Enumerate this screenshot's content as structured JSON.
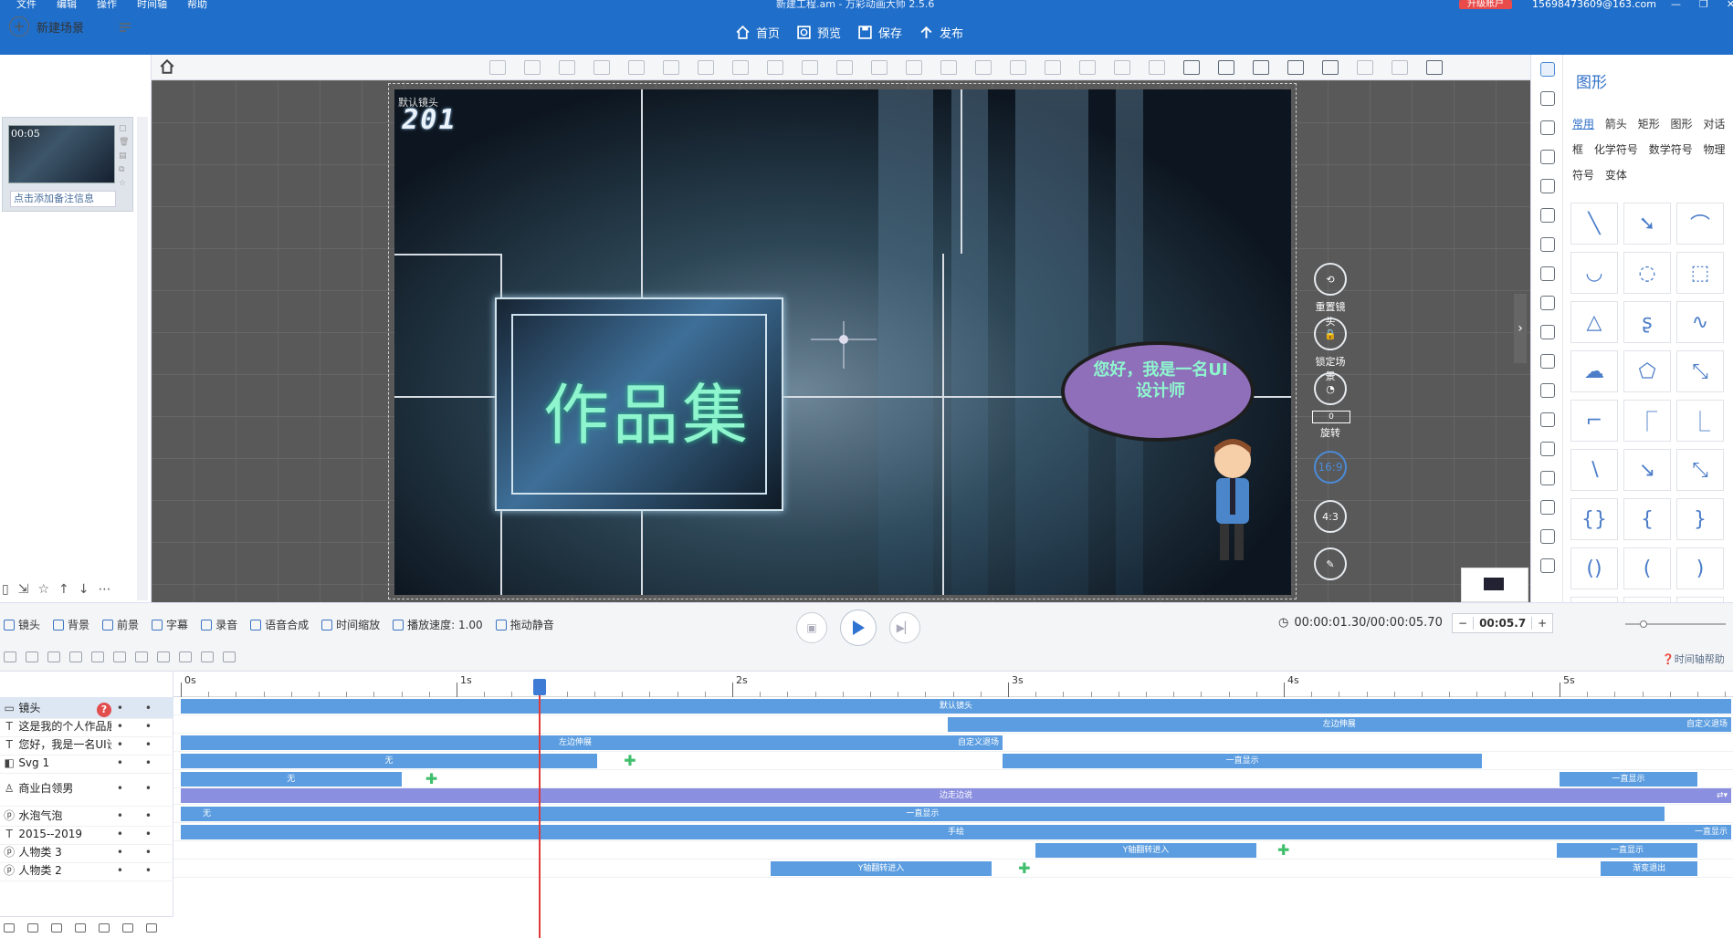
{
  "app": {
    "window_title": "新建工程.am - 万彩动画大师 2.5.6",
    "menu": [
      "文件",
      "编辑",
      "操作",
      "时间轴",
      "帮助"
    ],
    "upgrade_label": "升级账户",
    "account": "15698473609@163.com",
    "window_controls": [
      "—",
      "❐",
      "✕"
    ]
  },
  "top_actions": [
    {
      "label": "首页",
      "icon": "home-icon"
    },
    {
      "label": "预览",
      "icon": "preview-icon"
    },
    {
      "label": "保存",
      "icon": "save-icon"
    },
    {
      "label": "发布",
      "icon": "publish-icon"
    }
  ],
  "scene_panel": {
    "new_scene_label": "新建场景",
    "scene": {
      "time": "00:05",
      "note_placeholder": "点击添加备注信息"
    }
  },
  "canvas": {
    "camera_label": "默认镜头",
    "logo_text": "201",
    "title_text": "作品集",
    "bubble_text": "您好，我是一名UI设计师",
    "side_controls": {
      "reset_label": "重置镜头",
      "lock_label": "锁定场景",
      "rotate_label": "旋转",
      "rotate_value": "0",
      "ratio_16_9": "16:9",
      "ratio_4_3": "4:3"
    }
  },
  "right_panel": {
    "title": "图形",
    "categories": [
      "常用",
      "箭头",
      "矩形",
      "图形",
      "对话框",
      "化学符号",
      "数学符号",
      "物理符号",
      "变体"
    ],
    "active_category": "常用",
    "shapes": [
      "╲",
      "➘",
      "⌒",
      "◡",
      "◌",
      "⬚",
      "△",
      "ʂ",
      "∿",
      "☁",
      "⬠",
      "⤡",
      "⌐",
      "⎾",
      "⎿",
      "∖",
      "↘",
      "⤡",
      "{}",
      "{",
      "}",
      "()",
      "(",
      ")",
      "▰",
      "⏢",
      "▲"
    ]
  },
  "timeline_controls": {
    "tools": [
      "镜头",
      "背景",
      "前景",
      "字幕",
      "录音",
      "语音合成",
      "时间缩放",
      "播放速度: 1.00",
      "拖动静音"
    ],
    "time_readout": "00:00:01.30/00:00:05.70",
    "zoom": "00:05.7",
    "zoom_minus": "−",
    "zoom_plus": "+",
    "help_label": "时间轴帮助"
  },
  "timeline": {
    "ticks": [
      "0s",
      "1s",
      "2s",
      "3s",
      "4s",
      "5s"
    ],
    "playhead_seconds": 1.3,
    "duration_seconds": 5.7,
    "tracks": [
      {
        "name": "镜头",
        "icon": "camera-icon",
        "selected": true
      },
      {
        "name": "这是我的个人作品展",
        "icon": "text-icon"
      },
      {
        "name": "您好，我是一名UI设",
        "icon": "text-icon"
      },
      {
        "name": "Svg 1",
        "icon": "svg-icon"
      },
      {
        "name": "商业白领男",
        "icon": "person-icon"
      },
      {
        "name": "水泡气泡",
        "icon": "bubble-icon"
      },
      {
        "name": "2015--2019",
        "icon": "text-icon"
      },
      {
        "name": "人物类 3",
        "icon": "bubble-icon"
      },
      {
        "name": "人物类 2",
        "icon": "bubble-icon"
      }
    ],
    "bars": [
      {
        "lane": 0,
        "start": 0,
        "end": 5.7,
        "label": "默认镜头",
        "edge": ""
      },
      {
        "lane": 1,
        "start": 2.78,
        "end": 5.7,
        "label": "左边伸展",
        "edge": "自定义退场"
      },
      {
        "lane": 2,
        "start": 0,
        "end": 2.98,
        "label": "左边伸展",
        "edge": "自定义退场",
        "label_pos": 0.46
      },
      {
        "lane": 3,
        "start": 0,
        "end": 1.51,
        "label": "无",
        "edge": ""
      },
      {
        "lane": 3,
        "start": 2.98,
        "end": 4.72,
        "label": "一直显示",
        "edge": ""
      },
      {
        "lane": 4,
        "start": 0,
        "end": 0.8,
        "label": "无",
        "edge": ""
      },
      {
        "lane": 4,
        "start": 5.0,
        "end": 5.5,
        "label": "一直显示",
        "edge": ""
      },
      {
        "lane": 5,
        "start": 0,
        "end": 5.7,
        "label": "边走边说",
        "edge": "⇄▾",
        "purple": true
      },
      {
        "lane": 6,
        "start": 0,
        "end": 5.38,
        "label": "一直显示",
        "edge": "",
        "head": "无"
      },
      {
        "lane": 7,
        "start": 0,
        "end": 5.7,
        "label": "手绘",
        "edge": "一直显示"
      },
      {
        "lane": 8,
        "start": 3.1,
        "end": 3.9,
        "label": "Y轴翻转进入",
        "edge": ""
      },
      {
        "lane": 8,
        "start": 4.99,
        "end": 5.5,
        "label": "一直显示",
        "edge": ""
      },
      {
        "lane": 9,
        "start": 2.14,
        "end": 2.94,
        "label": "Y轴翻转进入",
        "edge": ""
      },
      {
        "lane": 9,
        "start": 5.15,
        "end": 5.5,
        "label": "渐变退出",
        "edge": ""
      }
    ],
    "keyframes": [
      {
        "lane": 3,
        "t": 1.63
      },
      {
        "lane": 4,
        "t": 0.91
      },
      {
        "lane": 5,
        "t": 5.65
      },
      {
        "lane": 8,
        "t": 4.0
      },
      {
        "lane": 9,
        "t": 3.06
      }
    ]
  }
}
